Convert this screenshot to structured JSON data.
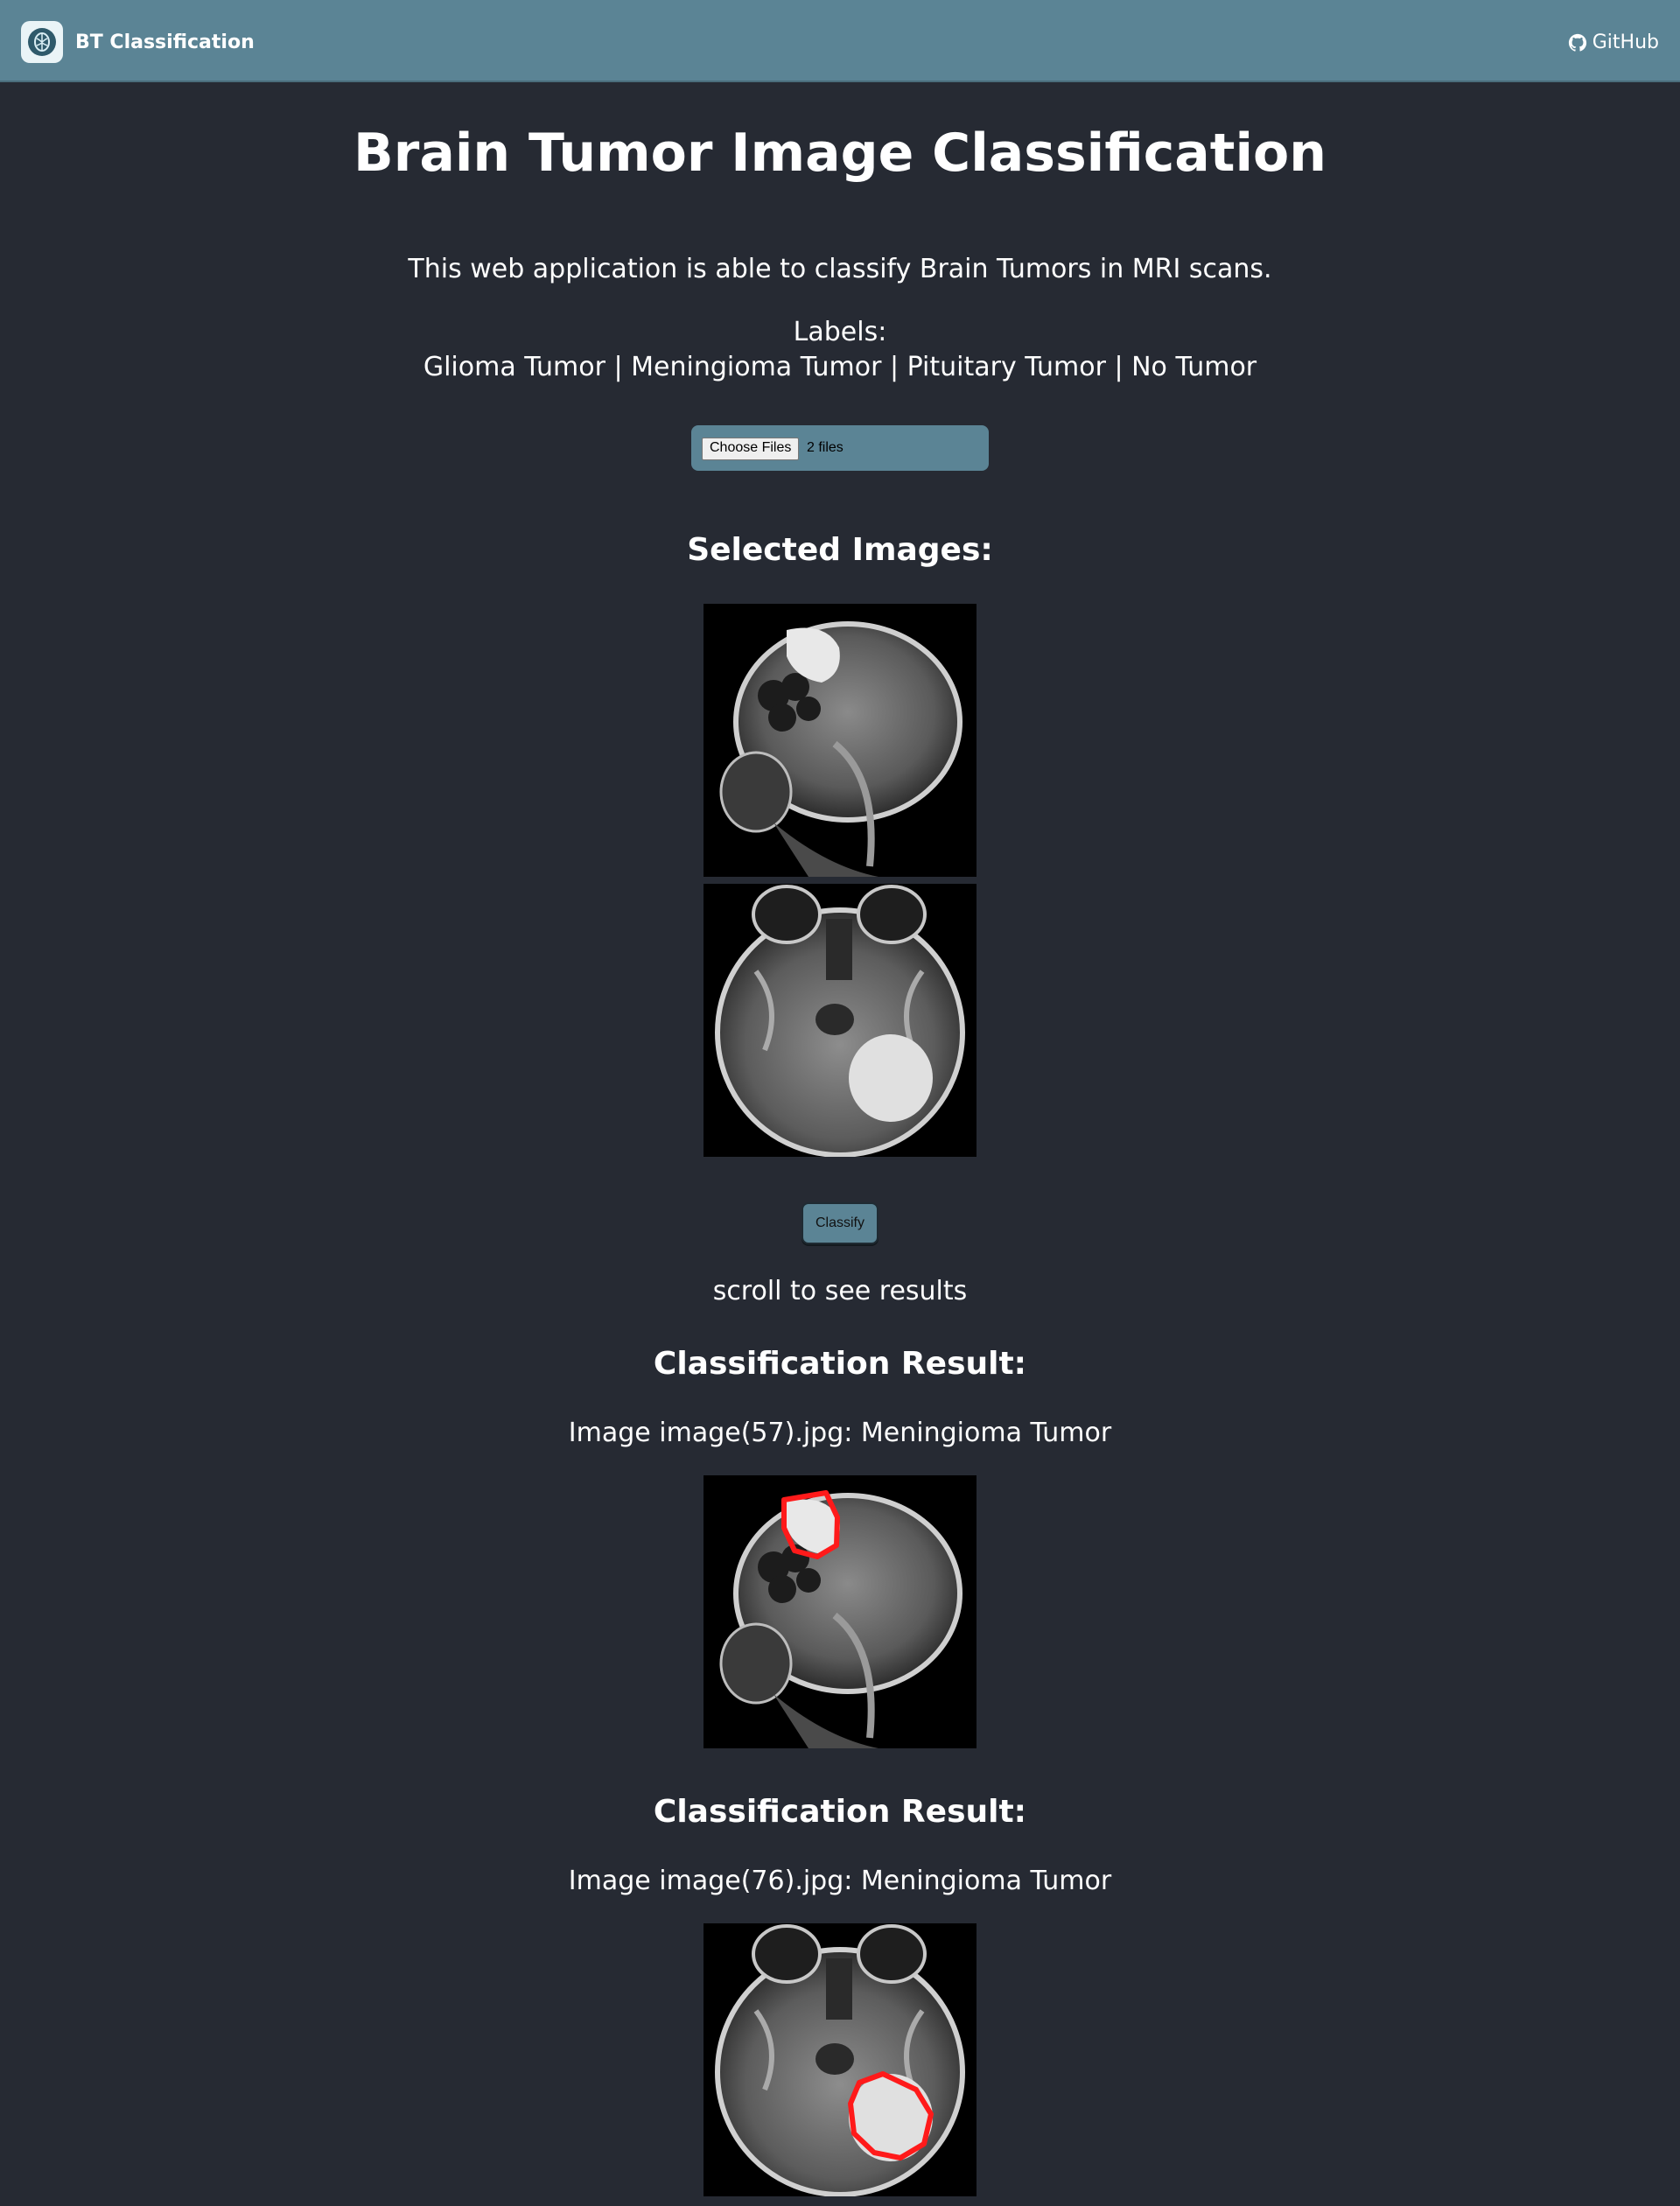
{
  "navbar": {
    "brand": "BT Classification",
    "github_label": "GitHub"
  },
  "main": {
    "title": "Brain Tumor Image Classification",
    "description": "This web application is able to classify Brain Tumors in MRI scans.",
    "labels_heading": "Labels:",
    "labels_list": "Glioma Tumor | Meningioma Tumor | Pituitary Tumor | No Tumor"
  },
  "upload": {
    "button_label": "Choose Files",
    "status": "2 files"
  },
  "selected": {
    "heading": "Selected Images:"
  },
  "actions": {
    "classify_label": "Classify",
    "scroll_hint": "scroll to see results"
  },
  "results": [
    {
      "heading": "Classification Result:",
      "text": "Image image(57).jpg: Meningioma Tumor"
    },
    {
      "heading": "Classification Result:",
      "text": "Image image(76).jpg: Meningioma Tumor"
    }
  ],
  "colors": {
    "background": "#262a33",
    "navbar": "#5b8495",
    "tumor_outline": "#ff1a1a"
  },
  "icons": [
    "brain-icon",
    "github-icon"
  ]
}
